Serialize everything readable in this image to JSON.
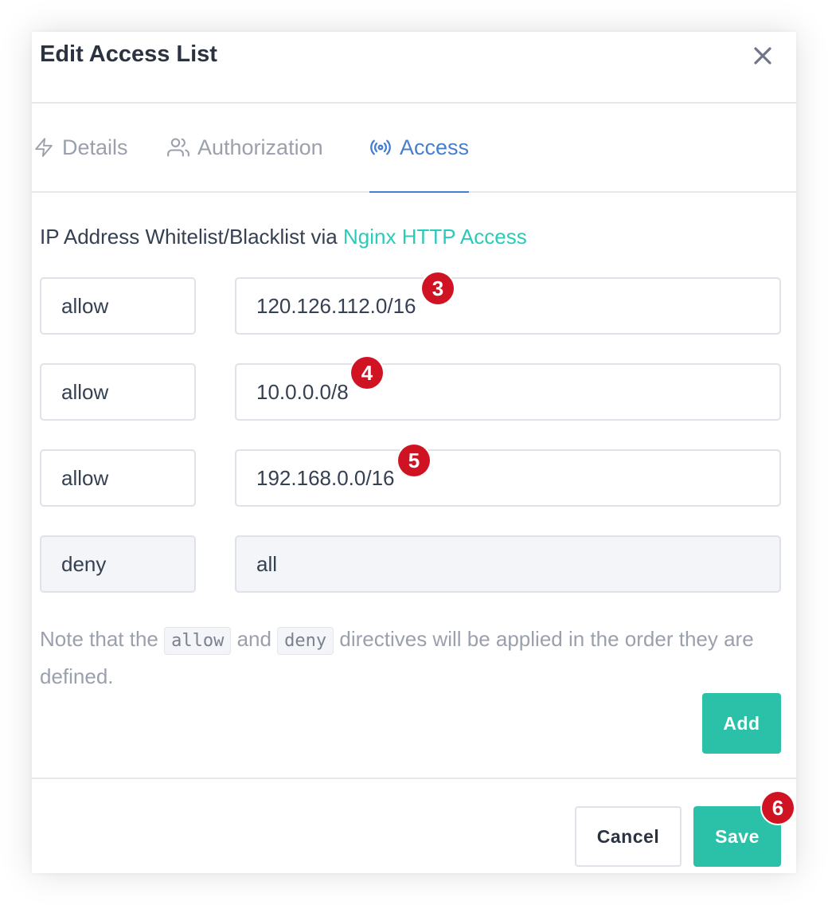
{
  "modal": {
    "title": "Edit Access List"
  },
  "tabs": [
    {
      "label": "Details",
      "icon": "lightning-icon",
      "active": false
    },
    {
      "label": "Authorization",
      "icon": "users-icon",
      "active": false
    },
    {
      "label": "Access",
      "icon": "radio-broadcast-icon",
      "active": true
    }
  ],
  "access": {
    "intro_text": "IP Address Whitelist/Blacklist via ",
    "intro_link": "Nginx HTTP Access",
    "rules": [
      {
        "directive": "allow",
        "address": "120.126.112.0/16",
        "badge": "3",
        "disabled": false
      },
      {
        "directive": "allow",
        "address": "10.0.0.0/8",
        "badge": "4",
        "disabled": false
      },
      {
        "directive": "allow",
        "address": "192.168.0.0/16",
        "badge": "5",
        "disabled": false
      },
      {
        "directive": "deny",
        "address": "all",
        "badge": "",
        "disabled": true
      }
    ],
    "note_prefix": "Note that the ",
    "note_code1": "allow",
    "note_middle": " and ",
    "note_code2": "deny",
    "note_suffix": " directives will be applied in the order they are defined."
  },
  "buttons": {
    "add": "Add",
    "cancel": "Cancel",
    "save": "Save",
    "save_badge": "6"
  },
  "colors": {
    "accent_blue": "#467fcf",
    "teal": "#2bc0a8",
    "link_teal": "#2bcbba",
    "badge_red": "#cf1322"
  }
}
